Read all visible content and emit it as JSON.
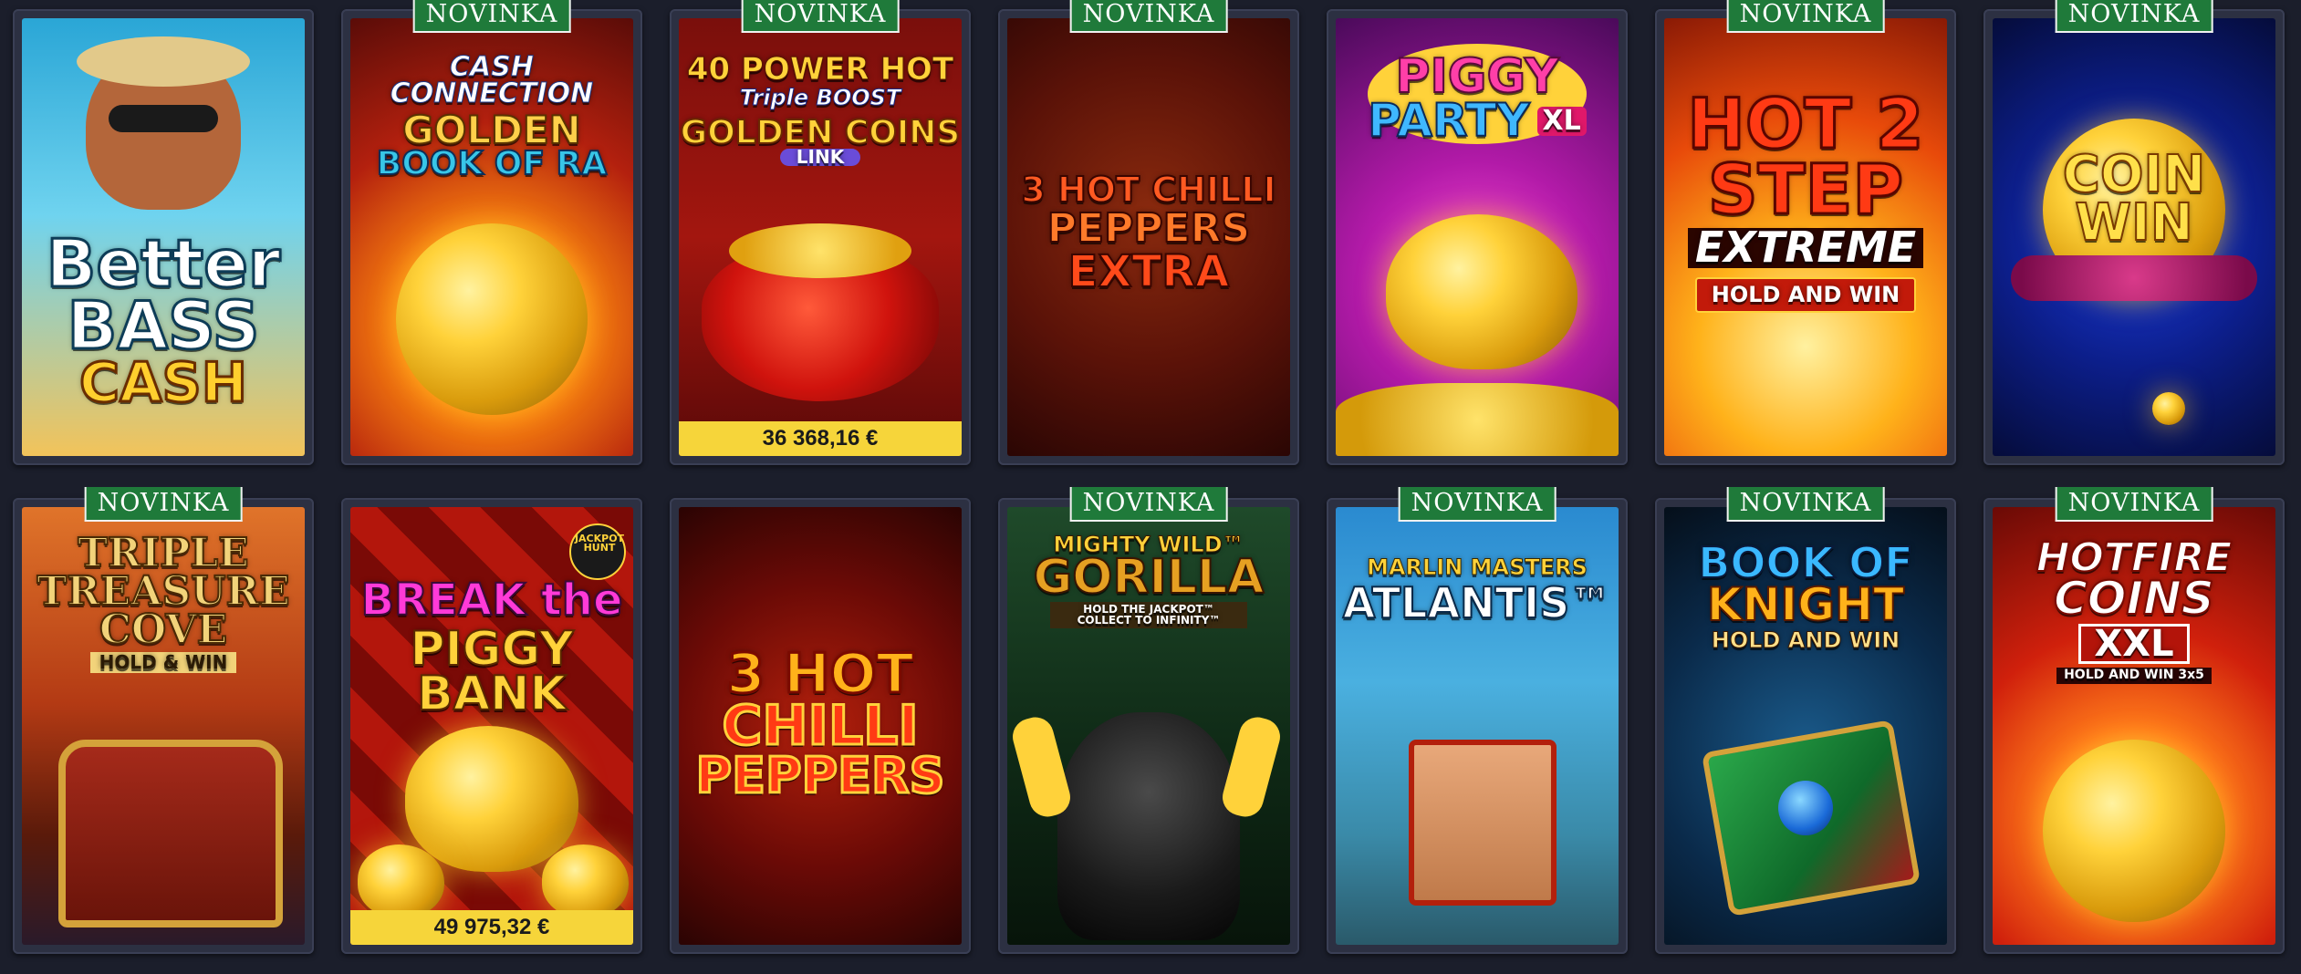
{
  "badge_label": "NOVINKA",
  "games": [
    {
      "title_1": "Better",
      "title_2": "BASS",
      "title_3": "CASH",
      "new": false
    },
    {
      "title_1": "CASH CONNECTION",
      "title_2": "GOLDEN",
      "title_3": "BOOK OF RA",
      "new": true
    },
    {
      "title_1": "40 POWER HOT",
      "title_2": "Triple BOOST",
      "title_3": "GOLDEN COINS",
      "title_4": "LINK",
      "new": true,
      "jackpot": "36 368,16 €"
    },
    {
      "title_1": "3 HOT CHILLI",
      "title_2": "PEPPERS",
      "title_3": "EXTRA",
      "new": true
    },
    {
      "title_1": "PIGGY",
      "title_2": "PARTY",
      "title_3": "XL",
      "new": false
    },
    {
      "title_1": "HOT 2",
      "title_2": "STEP",
      "title_3": "EXTREME",
      "title_4": "HOLD AND WIN",
      "new": true
    },
    {
      "title_1": "COIN",
      "title_2": "WIN",
      "new": true
    },
    {
      "title_1": "TRIPLE",
      "title_2": "TREASURE",
      "title_3": "COVE",
      "title_4": "HOLD & WIN",
      "new": true
    },
    {
      "title_1": "BREAK the",
      "title_2": "PIGGY BANK",
      "title_3": "JACKPOT HUNT",
      "new": false,
      "jackpot": "49 975,32 €"
    },
    {
      "title_1": "3 HOT",
      "title_2": "CHILLI",
      "title_3": "PEPPERS",
      "new": false
    },
    {
      "title_1": "MIGHTY WILD™",
      "title_2": "GORILLA",
      "title_3": "HOLD THE JACKPOT™ COLLECT TO INFINITY™",
      "new": true
    },
    {
      "title_1": "MARLIN MASTERS",
      "title_2": "ATLANTIS™",
      "new": true
    },
    {
      "title_1": "BOOK OF",
      "title_2": "KNIGHT",
      "title_3": "HOLD AND WIN",
      "new": true
    },
    {
      "title_1": "HOTFIRE",
      "title_2": "COINS",
      "title_3": "XXL",
      "title_4": "HOLD AND WIN 3x5",
      "new": true
    }
  ],
  "colors": {
    "page_bg": "#1b1e2b",
    "tile_frame": "#2c3042",
    "badge_bg": "#1f7a3a",
    "jackpot_bg": "#f6d53a"
  }
}
